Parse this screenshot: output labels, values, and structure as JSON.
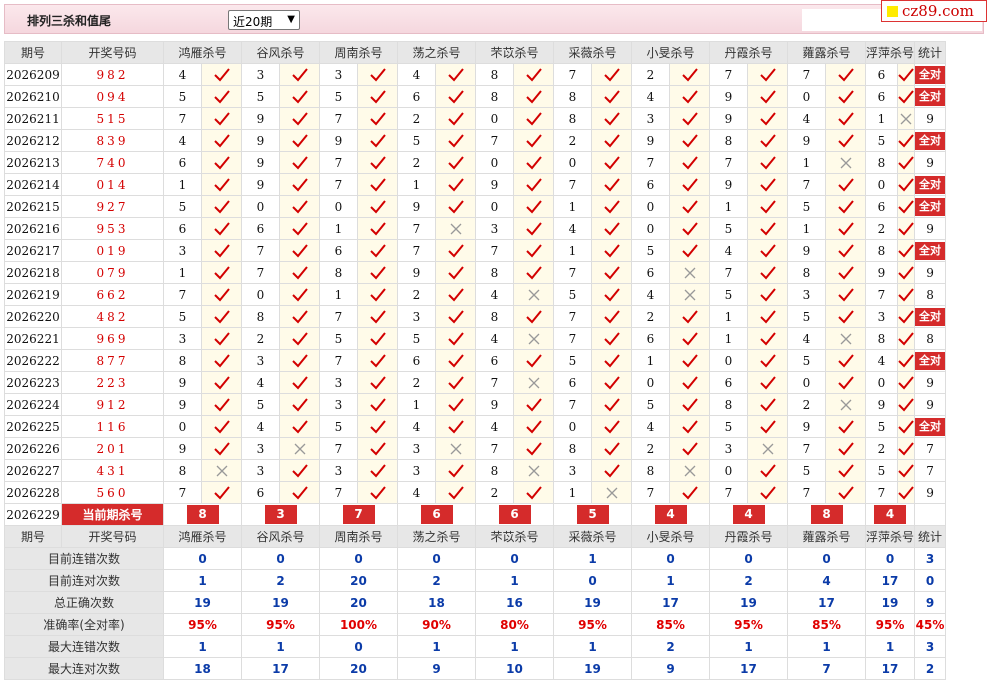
{
  "header": {
    "title": "排列三杀和值尾",
    "period_select": "近20期"
  },
  "logo": {
    "text": "cz89.com"
  },
  "columns": {
    "period": "期号",
    "draw": "开奖号码",
    "experts": [
      "鸿雁杀号",
      "谷风杀号",
      "周南杀号",
      "荡之杀号",
      "芣苡杀号",
      "采薇杀号",
      "小旻杀号",
      "丹霞杀号",
      "蕹露杀号",
      "浮萍杀号"
    ],
    "stat": "统计"
  },
  "rows": [
    {
      "period": "2026209",
      "draw": "982",
      "kills": [
        "4",
        "3",
        "3",
        "4",
        "8",
        "7",
        "2",
        "7",
        "7",
        "6"
      ],
      "hits": [
        1,
        1,
        1,
        1,
        1,
        1,
        1,
        1,
        1,
        1
      ],
      "stat": "全对"
    },
    {
      "period": "2026210",
      "draw": "094",
      "kills": [
        "5",
        "5",
        "5",
        "6",
        "8",
        "8",
        "4",
        "9",
        "0",
        "6"
      ],
      "hits": [
        1,
        1,
        1,
        1,
        1,
        1,
        1,
        1,
        1,
        1
      ],
      "stat": "全对"
    },
    {
      "period": "2026211",
      "draw": "515",
      "kills": [
        "7",
        "9",
        "7",
        "2",
        "0",
        "8",
        "3",
        "9",
        "4",
        "1"
      ],
      "hits": [
        1,
        1,
        1,
        1,
        1,
        1,
        1,
        1,
        1,
        0
      ],
      "stat": "9"
    },
    {
      "period": "2026212",
      "draw": "839",
      "kills": [
        "4",
        "9",
        "9",
        "5",
        "7",
        "2",
        "9",
        "8",
        "9",
        "5"
      ],
      "hits": [
        1,
        1,
        1,
        1,
        1,
        1,
        1,
        1,
        1,
        1
      ],
      "stat": "全对"
    },
    {
      "period": "2026213",
      "draw": "740",
      "kills": [
        "6",
        "9",
        "7",
        "2",
        "0",
        "0",
        "7",
        "7",
        "1",
        "8"
      ],
      "hits": [
        1,
        1,
        1,
        1,
        1,
        1,
        1,
        1,
        0,
        1
      ],
      "stat": "9"
    },
    {
      "period": "2026214",
      "draw": "014",
      "kills": [
        "1",
        "9",
        "7",
        "1",
        "9",
        "7",
        "6",
        "9",
        "7",
        "0"
      ],
      "hits": [
        1,
        1,
        1,
        1,
        1,
        1,
        1,
        1,
        1,
        1
      ],
      "stat": "全对"
    },
    {
      "period": "2026215",
      "draw": "927",
      "kills": [
        "5",
        "0",
        "0",
        "9",
        "0",
        "1",
        "0",
        "1",
        "5",
        "6"
      ],
      "hits": [
        1,
        1,
        1,
        1,
        1,
        1,
        1,
        1,
        1,
        1
      ],
      "stat": "全对"
    },
    {
      "period": "2026216",
      "draw": "953",
      "kills": [
        "6",
        "6",
        "1",
        "7",
        "3",
        "4",
        "0",
        "5",
        "1",
        "2"
      ],
      "hits": [
        1,
        1,
        1,
        0,
        1,
        1,
        1,
        1,
        1,
        1
      ],
      "stat": "9"
    },
    {
      "period": "2026217",
      "draw": "019",
      "kills": [
        "3",
        "7",
        "6",
        "7",
        "7",
        "1",
        "5",
        "4",
        "9",
        "8"
      ],
      "hits": [
        1,
        1,
        1,
        1,
        1,
        1,
        1,
        1,
        1,
        1
      ],
      "stat": "全对"
    },
    {
      "period": "2026218",
      "draw": "079",
      "kills": [
        "1",
        "7",
        "8",
        "9",
        "8",
        "7",
        "6",
        "7",
        "8",
        "9"
      ],
      "hits": [
        1,
        1,
        1,
        1,
        1,
        1,
        0,
        1,
        1,
        1
      ],
      "stat": "9"
    },
    {
      "period": "2026219",
      "draw": "662",
      "kills": [
        "7",
        "0",
        "1",
        "2",
        "4",
        "5",
        "4",
        "5",
        "3",
        "7"
      ],
      "hits": [
        1,
        1,
        1,
        1,
        0,
        1,
        0,
        1,
        1,
        1
      ],
      "stat": "8"
    },
    {
      "period": "2026220",
      "draw": "482",
      "kills": [
        "5",
        "8",
        "7",
        "3",
        "8",
        "7",
        "2",
        "1",
        "5",
        "3"
      ],
      "hits": [
        1,
        1,
        1,
        1,
        1,
        1,
        1,
        1,
        1,
        1
      ],
      "stat": "全对"
    },
    {
      "period": "2026221",
      "draw": "969",
      "kills": [
        "3",
        "2",
        "5",
        "5",
        "4",
        "7",
        "6",
        "1",
        "4",
        "8"
      ],
      "hits": [
        1,
        1,
        1,
        1,
        0,
        1,
        1,
        1,
        0,
        1
      ],
      "stat": "8"
    },
    {
      "period": "2026222",
      "draw": "877",
      "kills": [
        "8",
        "3",
        "7",
        "6",
        "6",
        "5",
        "1",
        "0",
        "5",
        "4"
      ],
      "hits": [
        1,
        1,
        1,
        1,
        1,
        1,
        1,
        1,
        1,
        1
      ],
      "stat": "全对"
    },
    {
      "period": "2026223",
      "draw": "223",
      "kills": [
        "9",
        "4",
        "3",
        "2",
        "7",
        "6",
        "0",
        "6",
        "0",
        "0"
      ],
      "hits": [
        1,
        1,
        1,
        1,
        0,
        1,
        1,
        1,
        1,
        1
      ],
      "stat": "9"
    },
    {
      "period": "2026224",
      "draw": "912",
      "kills": [
        "9",
        "5",
        "3",
        "1",
        "9",
        "7",
        "5",
        "8",
        "2",
        "9"
      ],
      "hits": [
        1,
        1,
        1,
        1,
        1,
        1,
        1,
        1,
        0,
        1
      ],
      "stat": "9"
    },
    {
      "period": "2026225",
      "draw": "116",
      "kills": [
        "0",
        "4",
        "5",
        "4",
        "4",
        "0",
        "4",
        "5",
        "9",
        "5"
      ],
      "hits": [
        1,
        1,
        1,
        1,
        1,
        1,
        1,
        1,
        1,
        1
      ],
      "stat": "全对"
    },
    {
      "period": "2026226",
      "draw": "201",
      "kills": [
        "9",
        "3",
        "7",
        "3",
        "7",
        "8",
        "2",
        "3",
        "7",
        "2"
      ],
      "hits": [
        1,
        0,
        1,
        0,
        1,
        1,
        1,
        0,
        1,
        1
      ],
      "stat": "7"
    },
    {
      "period": "2026227",
      "draw": "431",
      "kills": [
        "8",
        "3",
        "3",
        "3",
        "8",
        "3",
        "8",
        "0",
        "5",
        "5"
      ],
      "hits": [
        0,
        1,
        1,
        1,
        0,
        1,
        0,
        1,
        1,
        1
      ],
      "stat": "7"
    },
    {
      "period": "2026228",
      "draw": "560",
      "kills": [
        "7",
        "6",
        "7",
        "4",
        "2",
        "1",
        "7",
        "7",
        "7",
        "7"
      ],
      "hits": [
        1,
        1,
        1,
        1,
        1,
        0,
        1,
        1,
        1,
        1
      ],
      "stat": "9"
    }
  ],
  "current": {
    "period": "2026229",
    "label": "当前期杀号",
    "kills": [
      "8",
      "3",
      "7",
      "6",
      "6",
      "5",
      "4",
      "4",
      "8",
      "4"
    ]
  },
  "summary": [
    {
      "label": "目前连错次数",
      "values": [
        "0",
        "0",
        "0",
        "0",
        "0",
        "1",
        "0",
        "0",
        "0",
        "0",
        "3"
      ]
    },
    {
      "label": "目前连对次数",
      "values": [
        "1",
        "2",
        "20",
        "2",
        "1",
        "0",
        "1",
        "2",
        "4",
        "17",
        "0"
      ]
    },
    {
      "label": "总正确次数",
      "values": [
        "19",
        "19",
        "20",
        "18",
        "16",
        "19",
        "17",
        "19",
        "17",
        "19",
        "9"
      ]
    },
    {
      "label": "准确率(全对率)",
      "values": [
        "95%",
        "95%",
        "100%",
        "90%",
        "80%",
        "95%",
        "85%",
        "95%",
        "85%",
        "95%",
        "45%"
      ]
    },
    {
      "label": "最大连错次数",
      "values": [
        "1",
        "1",
        "0",
        "1",
        "1",
        "1",
        "2",
        "1",
        "1",
        "1",
        "3"
      ]
    },
    {
      "label": "最大连对次数",
      "values": [
        "18",
        "17",
        "20",
        "9",
        "10",
        "19",
        "9",
        "17",
        "7",
        "17",
        "2"
      ]
    }
  ],
  "colors": {
    "accent_red": "#d52b2b",
    "rate_red": "#e00000",
    "value_blue": "#0b3ba8",
    "header_gray": "#e7e7e7",
    "mark_bg": "#fffbe9"
  },
  "icons": {
    "hit": "check-icon",
    "miss": "cross-icon"
  }
}
